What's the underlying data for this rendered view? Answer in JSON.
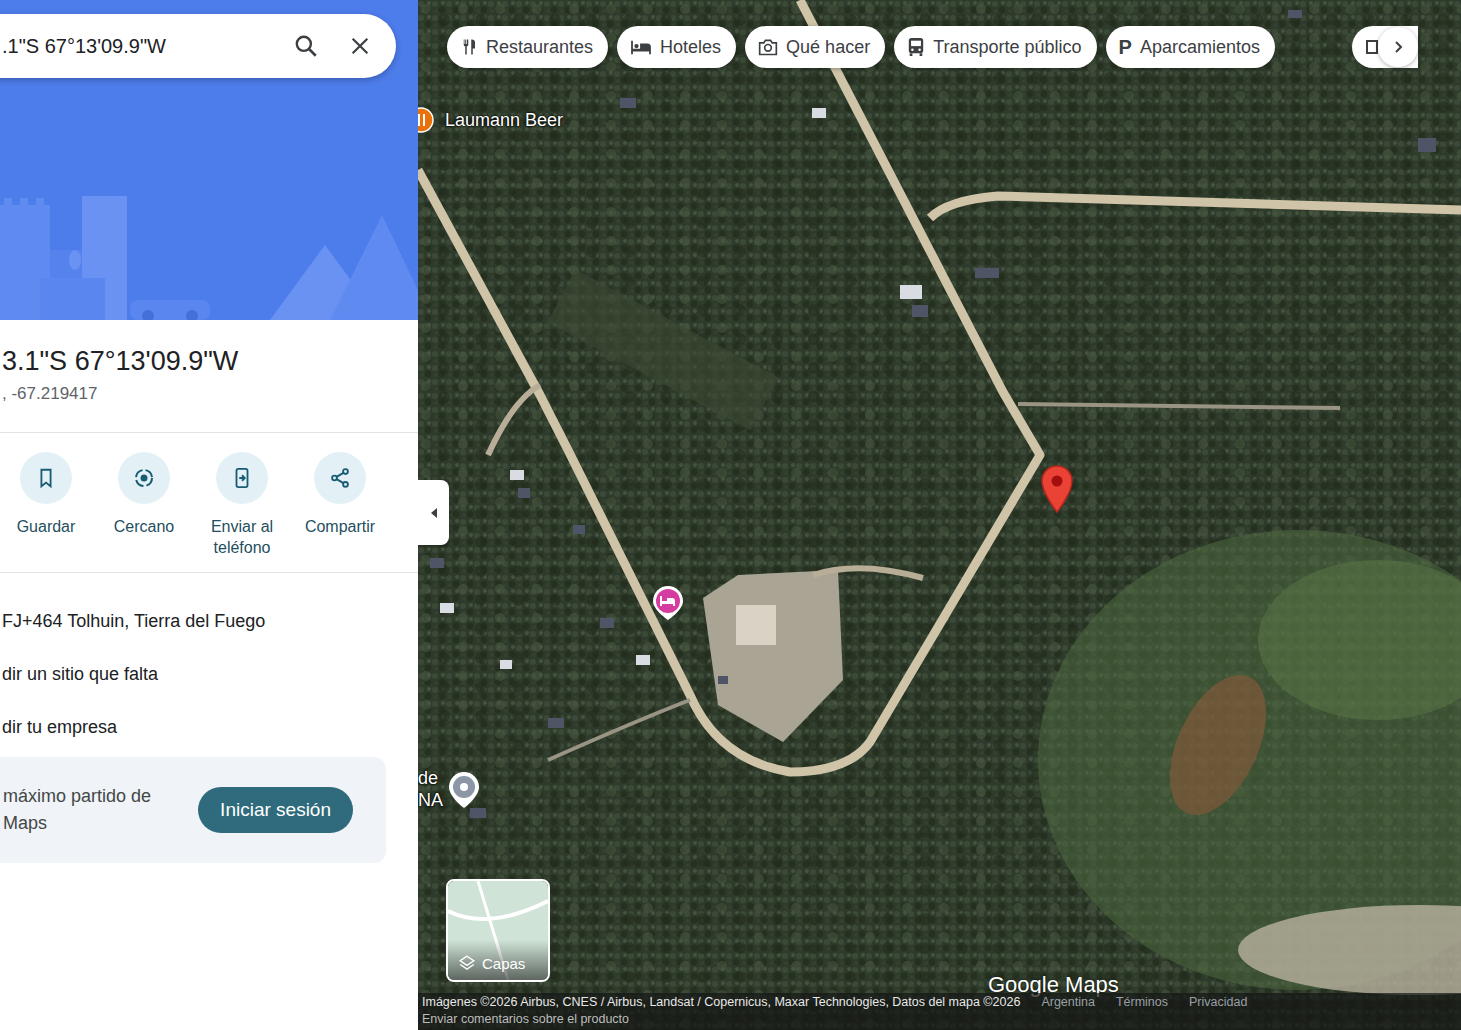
{
  "search": {
    "value": ".1\"S 67°13'09.9\"W"
  },
  "place": {
    "title": "3.1\"S 67°13'09.9\"W",
    "coordinates": ", -67.219417",
    "plus_code": "FJ+464 Tolhuin, Tierra del Fuego"
  },
  "actions": [
    {
      "label": "Guardar"
    },
    {
      "label": "Cercano"
    },
    {
      "label": "Enviar al teléfono"
    },
    {
      "label": "Compartir"
    }
  ],
  "links": [
    "dir un sitio que falta",
    "dir tu empresa"
  ],
  "signin": {
    "lines": [
      "máximo partido de",
      "Maps"
    ],
    "button": "Iniciar sesión"
  },
  "chips": [
    {
      "label": "Restaurantes",
      "glyph": ""
    },
    {
      "label": "Hoteles",
      "glyph": ""
    },
    {
      "label": "Qué hacer",
      "glyph": ""
    },
    {
      "label": "Transporte público",
      "glyph": ""
    },
    {
      "label": "Aparcamientos",
      "glyph": "P"
    }
  ],
  "pois": [
    {
      "kind": "restaurant",
      "lines": [
        "Laumann Beer"
      ]
    },
    {
      "kind": "place",
      "lines": [
        "de",
        "NA"
      ]
    },
    {
      "kind": "hotel",
      "lines": []
    },
    {
      "kind": "dropped",
      "lines": []
    }
  ],
  "layers": "Capas",
  "logo": "Google Maps",
  "footer": {
    "attribution": "Imágenes ©2026 Airbus, CNES / Airbus, Landsat / Copernicus, Maxar Technologies, Datos del mapa ©2026",
    "links": [
      "Argentina",
      "Términos",
      "Privacidad"
    ],
    "feedback": "Enviar comentarios sobre el producto"
  }
}
